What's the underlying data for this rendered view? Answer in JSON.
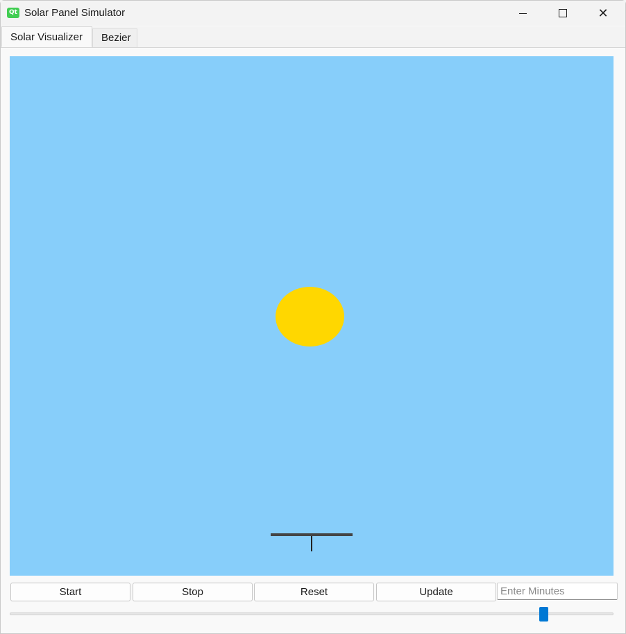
{
  "window": {
    "title": "Solar Panel Simulator",
    "app_icon_text": "Qt"
  },
  "tabs": [
    {
      "label": "Solar Visualizer",
      "active": true
    },
    {
      "label": "Bezier",
      "active": false
    }
  ],
  "scene": {
    "sky_color": "#87cefa",
    "sun_color": "#ffd700",
    "panel_color": "#444444"
  },
  "controls": {
    "start_label": "Start",
    "stop_label": "Stop",
    "reset_label": "Reset",
    "update_label": "Update",
    "minutes_placeholder": "Enter Minutes",
    "minutes_value": ""
  },
  "slider": {
    "value_fraction": 0.89,
    "accent_color": "#0078d4"
  }
}
